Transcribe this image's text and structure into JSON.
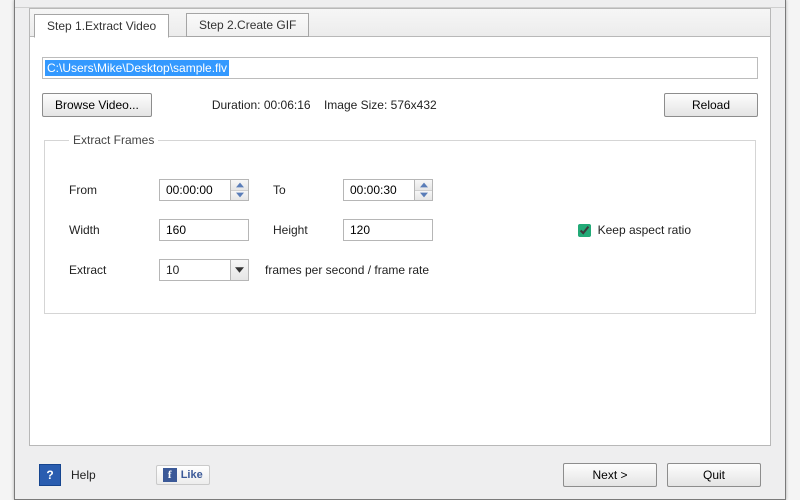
{
  "tabs": [
    {
      "label": "Step 1.Extract Video"
    },
    {
      "label": "Step 2.Create GIF"
    }
  ],
  "path": {
    "value": "C:\\Users\\Mike\\Desktop\\sample.flv"
  },
  "buttons": {
    "browse": "Browse Video...",
    "reload": "Reload",
    "next": "Next >",
    "quit": "Quit"
  },
  "meta": {
    "duration_label": "Duration:",
    "duration_value": "00:06:16",
    "imgsize_label": "Image Size:",
    "imgsize_value": "576x432"
  },
  "frames": {
    "legend": "Extract Frames",
    "from_label": "From",
    "from_value": "00:00:00",
    "to_label": "To",
    "to_value": "00:00:30",
    "width_label": "Width",
    "width_value": "160",
    "height_label": "Height",
    "height_value": "120",
    "keep_label": "Keep aspect ratio",
    "keep_checked": true,
    "extract_label": "Extract",
    "extract_value": "10",
    "fps_text": "frames per second / frame rate"
  },
  "footer": {
    "help_label": "Help",
    "like_label": "Like"
  }
}
